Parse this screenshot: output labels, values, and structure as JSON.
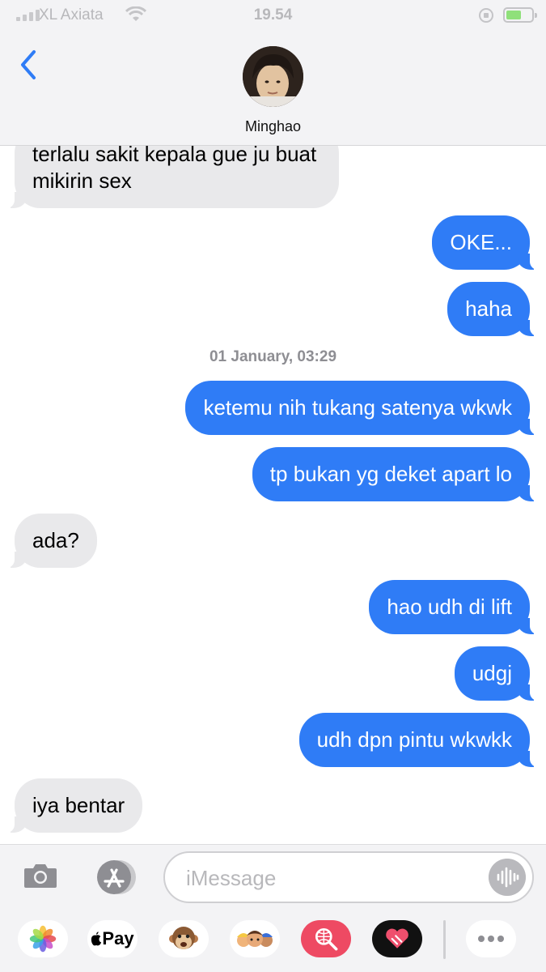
{
  "status_bar": {
    "carrier": "XL Axiata",
    "time": "19.54",
    "icons": [
      "signal-icon",
      "wifi-icon",
      "rotation-lock-icon",
      "battery-charging-icon"
    ]
  },
  "header": {
    "back_icon": "chevron-left-icon",
    "contact_name": "Minghao"
  },
  "messages": [
    {
      "side": "in",
      "lines": [
        "terlalu sakit kepala gue ju buat",
        "mikirin sex"
      ]
    },
    {
      "side": "out",
      "lines": [
        "OKE..."
      ]
    },
    {
      "side": "out",
      "lines": [
        "haha"
      ]
    },
    {
      "timestamp": "01 January, 03:29"
    },
    {
      "side": "out",
      "lines": [
        "ketemu nih tukang satenya wkwk"
      ]
    },
    {
      "side": "out",
      "lines": [
        "tp bukan yg deket apart lo"
      ]
    },
    {
      "side": "in",
      "lines": [
        "ada?"
      ]
    },
    {
      "side": "out",
      "lines": [
        "hao udh di lift"
      ]
    },
    {
      "side": "out",
      "lines": [
        "udgj"
      ]
    },
    {
      "side": "out",
      "lines": [
        "udh dpn pintu wkwkk"
      ]
    },
    {
      "side": "in",
      "lines": [
        "iya bentar"
      ]
    }
  ],
  "composer": {
    "placeholder": "iMessage",
    "value": "",
    "icons": [
      "camera-icon",
      "app-store-icon",
      "audio-waveform-icon"
    ]
  },
  "app_drawer": {
    "apple_pay_label": "Pay",
    "apps": [
      "photos-icon",
      "apple-pay-icon",
      "animoji-monkey-icon",
      "memoji-icon",
      "web-search-icon",
      "digital-touch-icon",
      "more-icon"
    ]
  },
  "colors": {
    "outgoing_bubble": "#2f7cf6",
    "incoming_bubble": "#e9e9eb",
    "header_background": "#f3f3f5",
    "accent": "#2f7cf6"
  }
}
